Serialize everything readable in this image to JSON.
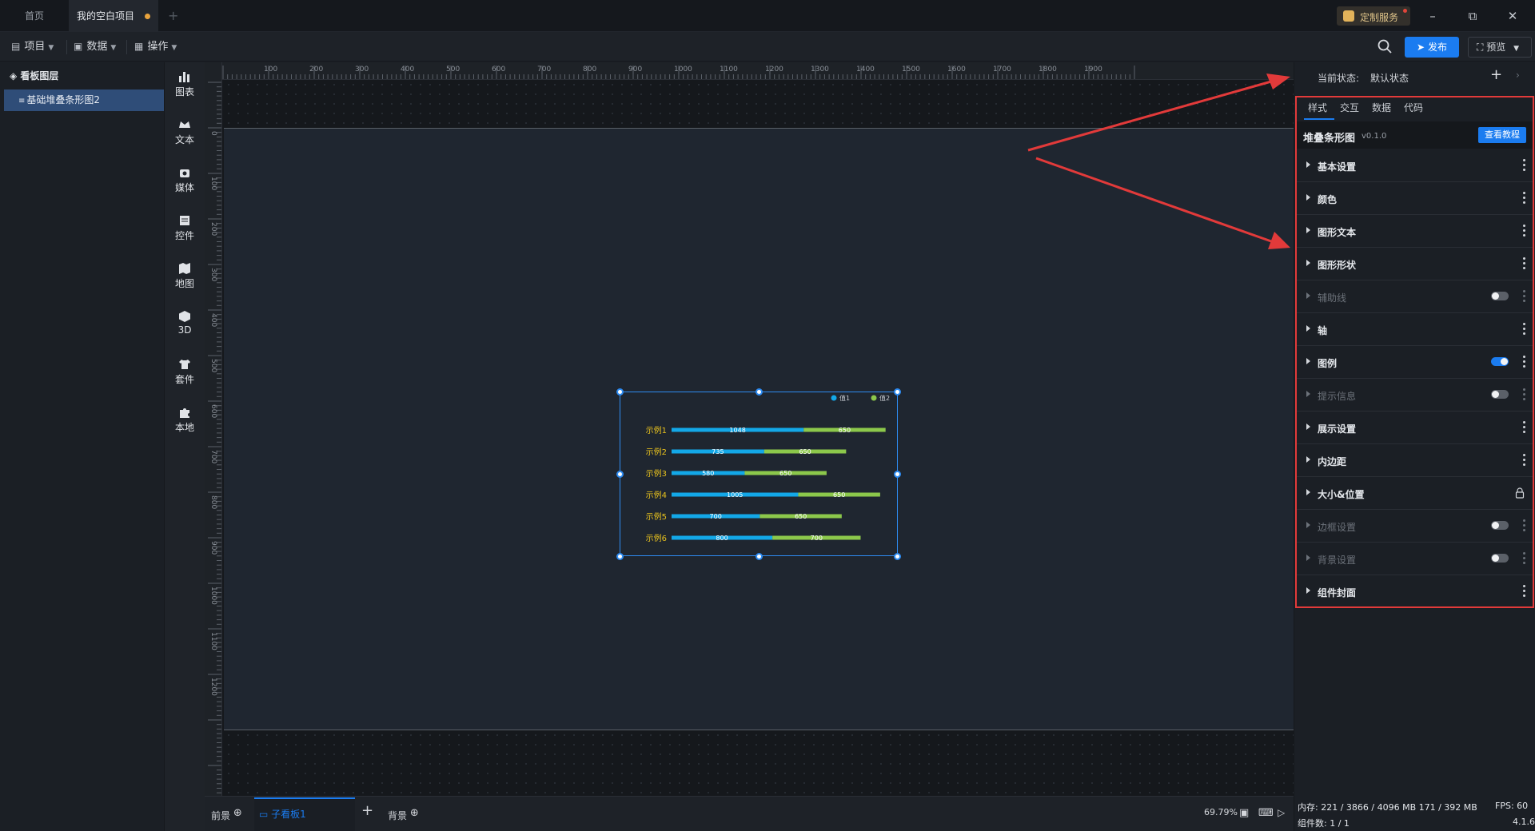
{
  "titlebar": {
    "tab_home": "首页",
    "tab_project": "我的空白项目",
    "custom_service": "定制服务"
  },
  "menubar": {
    "project": "项目",
    "data": "数据",
    "operate": "操作",
    "publish": "发布",
    "preview": "预览"
  },
  "layers": {
    "title": "看板图层",
    "item": "基础堆叠条形图2"
  },
  "tools": [
    "图表",
    "文本",
    "媒体",
    "控件",
    "地图",
    "3D",
    "套件",
    "本地"
  ],
  "rulers": {
    "top": [
      "100",
      "200",
      "300",
      "400",
      "500",
      "600",
      "700",
      "800",
      "900",
      "1000",
      "1100",
      "1200",
      "1300",
      "1400",
      "1500",
      "1600",
      "1700",
      "1800",
      "1900"
    ],
    "left": [
      "0",
      "100",
      "200",
      "300",
      "400",
      "500",
      "600",
      "700",
      "800",
      "900",
      "1000",
      "1100",
      "1200"
    ]
  },
  "chart_data": {
    "type": "bar",
    "orientation": "horizontal",
    "stacked": true,
    "categories": [
      "示例1",
      "示例2",
      "示例3",
      "示例4",
      "示例5",
      "示例6"
    ],
    "series": [
      {
        "name": "值1",
        "color": "#13a8e8",
        "values": [
          1048,
          735,
          580,
          1005,
          700,
          800
        ]
      },
      {
        "name": "值2",
        "color": "#8cc84b",
        "values": [
          650,
          650,
          650,
          650,
          650,
          700
        ]
      }
    ],
    "legend_position": "top-right",
    "category_label_color": "#e8c21e",
    "xlim": [
      0,
      1700
    ]
  },
  "bottombar": {
    "foreground": "前景",
    "subboard": "子看板1",
    "background": "背景",
    "zoom": "69.79%"
  },
  "rightpanel": {
    "state_label": "当前状态:",
    "state_value": "默认状态",
    "tabs": [
      "样式",
      "交互",
      "数据",
      "代码"
    ],
    "component_name": "堆叠条形图",
    "component_version": "v0.1.0",
    "tutorial": "查看教程",
    "sections": [
      {
        "label": "基本设置",
        "enabled": true,
        "control": "more"
      },
      {
        "label": "颜色",
        "enabled": true,
        "control": "more"
      },
      {
        "label": "图形文本",
        "enabled": true,
        "control": "more"
      },
      {
        "label": "图形形状",
        "enabled": true,
        "control": "more"
      },
      {
        "label": "辅助线",
        "enabled": false,
        "control": "toggle-off"
      },
      {
        "label": "轴",
        "enabled": true,
        "control": "more"
      },
      {
        "label": "图例",
        "enabled": true,
        "control": "toggle-on"
      },
      {
        "label": "提示信息",
        "enabled": false,
        "control": "toggle-off"
      },
      {
        "label": "展示设置",
        "enabled": true,
        "control": "more"
      },
      {
        "label": "内边距",
        "enabled": true,
        "control": "more"
      },
      {
        "label": "大小&位置",
        "enabled": true,
        "control": "lock"
      },
      {
        "label": "边框设置",
        "enabled": false,
        "control": "toggle-off"
      },
      {
        "label": "背景设置",
        "enabled": false,
        "control": "toggle-off"
      },
      {
        "label": "组件封面",
        "enabled": true,
        "control": "more"
      }
    ]
  },
  "status": {
    "memory": "内存:  221 / 3866 / 4096 MB  171 / 392 MB",
    "fps": "FPS:  60",
    "components": "组件数: 1 / 1",
    "version": "4.1.6"
  },
  "colors": {
    "accent": "#1b7cf0",
    "annotation": "#e23a3a"
  }
}
